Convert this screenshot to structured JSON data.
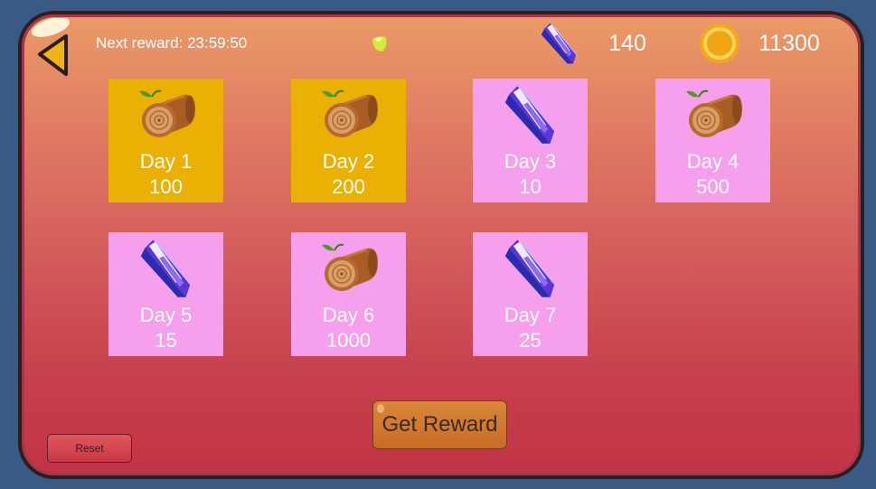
{
  "header": {
    "next_reward_label": "Next reward: 23:59:50",
    "crystal_count": "140",
    "coin_count": "11300"
  },
  "rewards": [
    {
      "day": "Day 1",
      "amount": "100",
      "item": "wood-log",
      "state": "claimed"
    },
    {
      "day": "Day 2",
      "amount": "200",
      "item": "wood-log",
      "state": "claimed"
    },
    {
      "day": "Day 3",
      "amount": "10",
      "item": "crystal",
      "state": "pending"
    },
    {
      "day": "Day 4",
      "amount": "500",
      "item": "wood-log",
      "state": "pending"
    },
    {
      "day": "Day 5",
      "amount": "15",
      "item": "crystal",
      "state": "pending"
    },
    {
      "day": "Day 6",
      "amount": "1000",
      "item": "wood-log",
      "state": "pending"
    },
    {
      "day": "Day 7",
      "amount": "25",
      "item": "crystal",
      "state": "pending"
    }
  ],
  "buttons": {
    "get_reward": "Get Reward",
    "reset": "Reset"
  },
  "colors": {
    "claimed_card": "#eab004",
    "pending_card": "#f69fed",
    "panel_top": "#eb9a67",
    "panel_bottom": "#c23447",
    "get_reward_button": "#d07a2e",
    "reset_button": "#d54a54"
  }
}
